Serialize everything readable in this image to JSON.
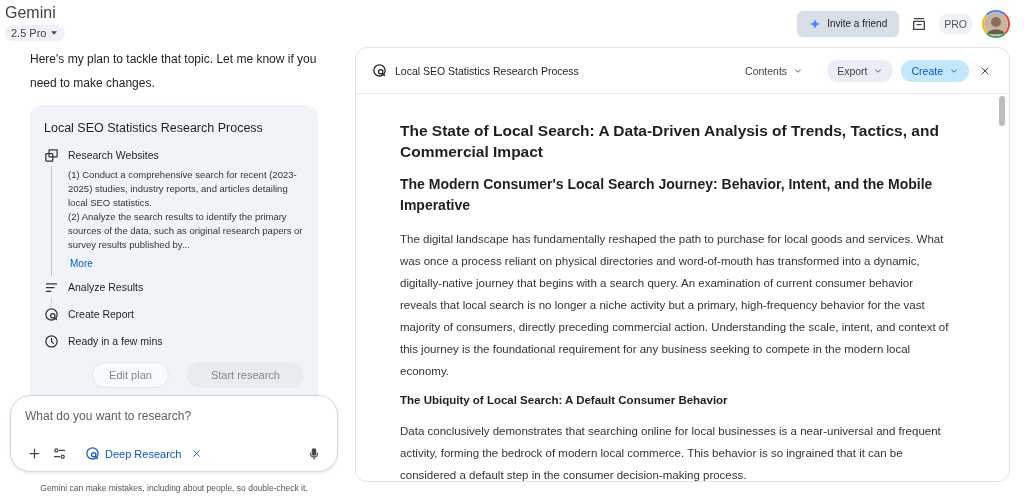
{
  "app": {
    "title": "Gemini",
    "model": "2.5 Pro"
  },
  "top_bar": {
    "invite": "Invite a friend",
    "plan_badge": "PRO"
  },
  "chat": {
    "message": "Here's my plan to tackle that topic. Let me know if you need to make changes.",
    "plan": {
      "title": "Local SEO Statistics Research Process",
      "steps": [
        {
          "kind": "websites",
          "label": "Research Websites",
          "details": [
            "(1) Conduct a comprehensive search for recent (2023-2025) studies, industry reports, and articles detailing local SEO statistics.",
            "(2) Analyze the search results to identify the primary sources of the data, such as original research papers or survey results published by..."
          ],
          "more": "More"
        },
        {
          "kind": "analyze",
          "label": "Analyze Results"
        },
        {
          "kind": "report",
          "label": "Create Report"
        },
        {
          "kind": "time",
          "label": "Ready in a few mins"
        }
      ],
      "buttons": [
        {
          "label": "Edit plan",
          "kind": "outline"
        },
        {
          "label": "Start research",
          "kind": "filled"
        }
      ]
    }
  },
  "composer": {
    "placeholder": "What do you want to research?",
    "tool": "Deep Research"
  },
  "disclaimer": "Gemini can make mistakes, including about people, so double-check it.",
  "document": {
    "title": "Local SEO Statistics Research Process",
    "actions": [
      {
        "label": "Contents",
        "kind": "plain"
      },
      {
        "label": "Export",
        "kind": "tonal"
      },
      {
        "label": "Create",
        "kind": "primary"
      }
    ],
    "blocks": [
      {
        "kind": "h1",
        "text": "The State of Local Search: A Data-Driven Analysis of Trends, Tactics, and Commercial Impact"
      },
      {
        "kind": "h2",
        "text": "The Modern Consumer's Local Search Journey: Behavior, Intent, and the Mobile Imperative"
      },
      {
        "kind": "p",
        "text": "The digital landscape has fundamentally reshaped the path to purchase for local goods and services. What was once a process reliant on physical directories and word-of-mouth has transformed into a dynamic, digitally-native journey that begins with a search query. An examination of current consumer behavior reveals that local search is no longer a niche activity but a primary, high-frequency behavior for the vast majority of consumers, directly preceding commercial action. Understanding the scale, intent, and context of this journey is the foundational requirement for any business seeking to compete in the modern local economy."
      },
      {
        "kind": "h3",
        "text": "The Ubiquity of Local Search: A Default Consumer Behavior"
      },
      {
        "kind": "p",
        "text": "Data conclusively demonstrates that searching online for local businesses is a near-universal and frequent activity, forming the bedrock of modern local commerce. This behavior is so ingrained that it can be considered a default step in the consumer decision-making process."
      }
    ]
  }
}
